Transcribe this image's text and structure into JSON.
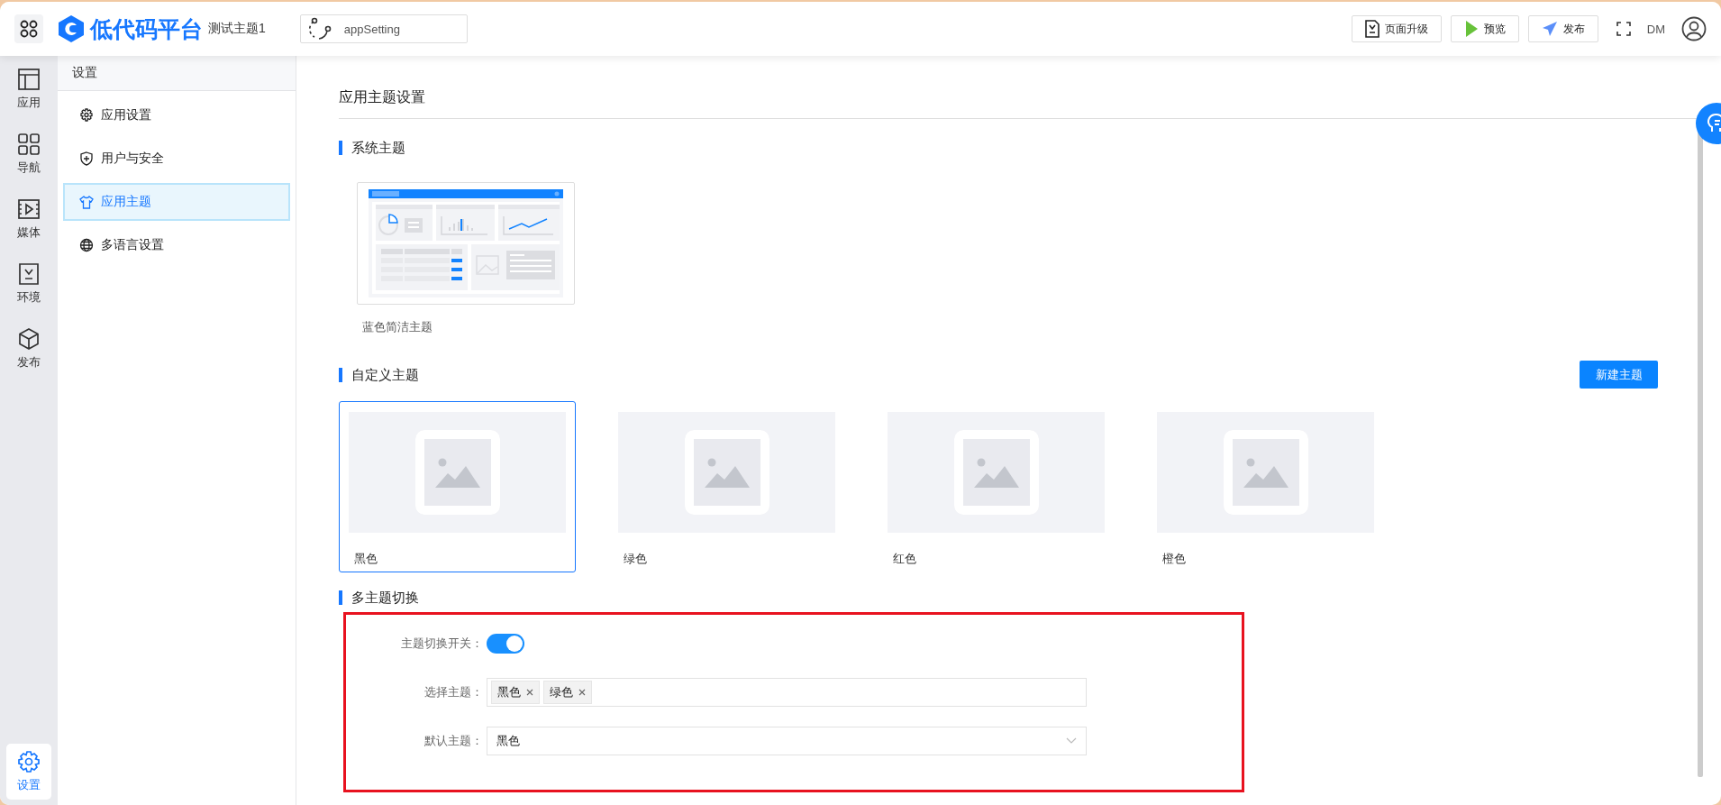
{
  "topbar": {
    "logo_text": "低代码平台",
    "app_name": "测试主题1",
    "page_select": "appSetting",
    "buttons": [
      {
        "kind": "upgrade",
        "label": "页面升级"
      },
      {
        "kind": "preview",
        "label": "预览"
      },
      {
        "kind": "publish",
        "label": "发布"
      }
    ],
    "user_initials": "DM"
  },
  "rail": [
    {
      "kind": "app",
      "label": "应用",
      "selected": false
    },
    {
      "kind": "nav",
      "label": "导航",
      "selected": false
    },
    {
      "kind": "media",
      "label": "媒体",
      "selected": false
    },
    {
      "kind": "env",
      "label": "环境",
      "selected": false
    },
    {
      "kind": "publish",
      "label": "发布",
      "selected": false
    },
    {
      "kind": "settings",
      "label": "设置",
      "selected": true
    }
  ],
  "sidebar": {
    "title": "设置",
    "items": [
      {
        "kind": "gear",
        "label": "应用设置",
        "selected": false
      },
      {
        "kind": "shield",
        "label": "用户与安全",
        "selected": false
      },
      {
        "kind": "shirt",
        "label": "应用主题",
        "selected": true
      },
      {
        "kind": "globe",
        "label": "多语言设置",
        "selected": false
      }
    ]
  },
  "content": {
    "title": "应用主题设置",
    "system_section": {
      "title": "系统主题",
      "themes": [
        {
          "label": "蓝色简洁主题"
        }
      ]
    },
    "custom_section": {
      "title": "自定义主题",
      "new_button": "新建主题",
      "themes": [
        {
          "label": "黑色",
          "selected": true
        },
        {
          "label": "绿色",
          "selected": false
        },
        {
          "label": "红色",
          "selected": false
        },
        {
          "label": "橙色",
          "selected": false
        }
      ]
    },
    "switch_section": {
      "title": "多主题切换",
      "toggle_label": "主题切换开关：",
      "toggle_on": true,
      "select_label": "选择主题：",
      "selected_tags": [
        "黑色",
        "绿色"
      ],
      "default_label": "默认主题：",
      "default_value": "黑色"
    }
  }
}
